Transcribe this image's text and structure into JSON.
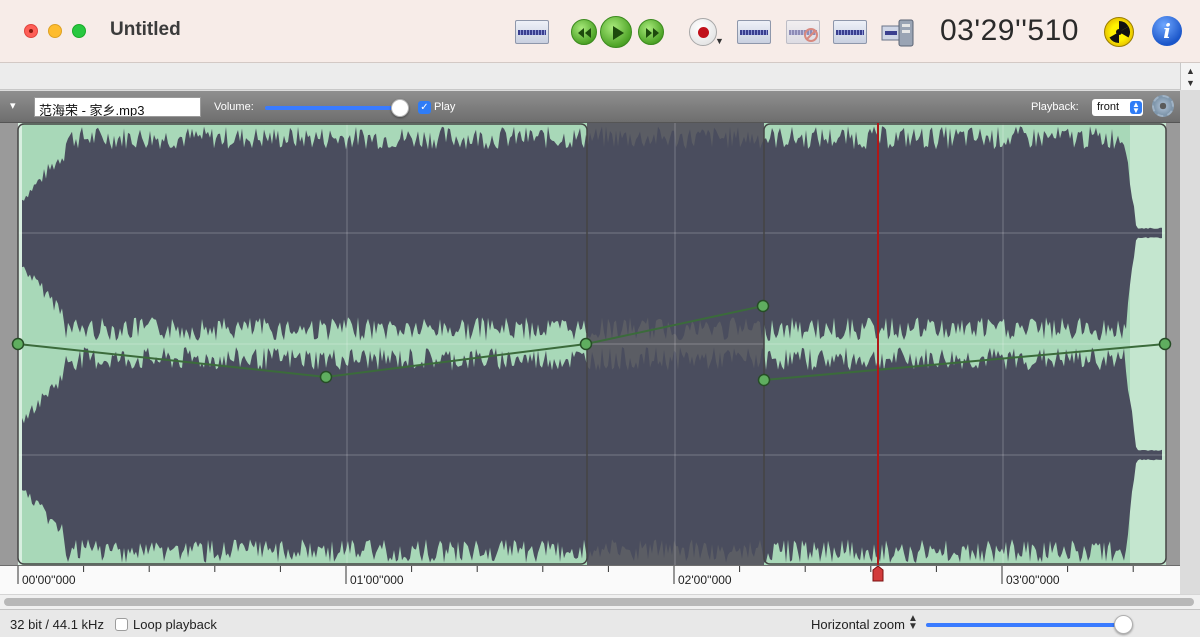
{
  "window": {
    "title": "Untitled",
    "time_readout": "03'29''510"
  },
  "toolbar": {
    "icons": [
      "waveform-icon",
      "rewind-icon",
      "play-icon",
      "fast-forward-icon",
      "record-icon",
      "waveform-edit-icon",
      "waveform-disabled-icon",
      "waveform-split-icon",
      "export-icon",
      "radiation-icon",
      "info-icon"
    ],
    "info_label": "i"
  },
  "track": {
    "file_name": "范海荣 - 家乡.mp3",
    "volume_label": "Volume:",
    "volume_level": 0.92,
    "play_label": "Play",
    "play_checked": true,
    "playback_label": "Playback:",
    "playback_value": "front"
  },
  "timeline": {
    "labels": [
      "00'00''000",
      "01'00''000",
      "02'00''000",
      "03'00''000"
    ],
    "playhead_time": "03'29''510"
  },
  "status": {
    "format": "32 bit / 44.1 kHz",
    "loop_label": "Loop playback",
    "loop_checked": false,
    "zoom_label": "Horizontal zoom",
    "zoom_level": 0.98
  },
  "colors": {
    "wave_fill": "#4a4d5e",
    "selection_bg": "#a8d8b8",
    "envelope": "#3b6b3b",
    "playhead": "#b01818"
  }
}
